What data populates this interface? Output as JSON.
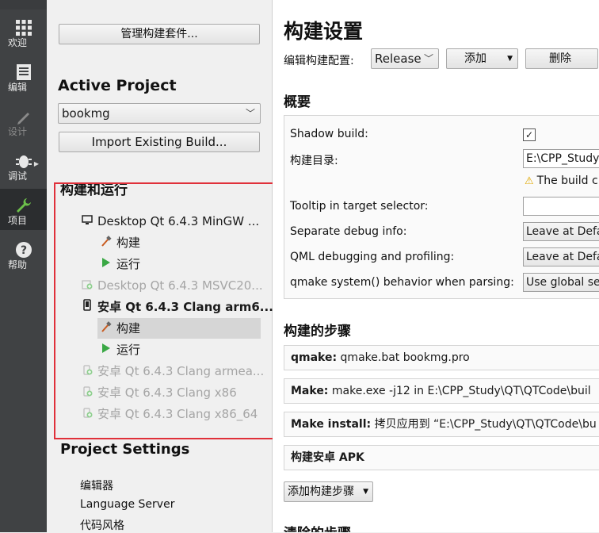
{
  "modebar": {
    "items": [
      {
        "label": "欢迎",
        "icon": "grid-icon"
      },
      {
        "label": "编辑",
        "icon": "document-icon"
      },
      {
        "label": "设计",
        "icon": "pen-icon"
      },
      {
        "label": "调试",
        "icon": "bug-icon"
      },
      {
        "label": "项目",
        "icon": "wrench-icon"
      },
      {
        "label": "帮助",
        "icon": "help-icon"
      }
    ]
  },
  "left": {
    "manage_kits_button": "管理构建套件...",
    "active_project_heading": "Active Project",
    "project_combo": "bookmg",
    "import_build_button": "Import Existing Build...",
    "build_run_heading": "构建和运行",
    "tree": [
      {
        "label": "Desktop Qt 6.4.3 MinGW ..."
      },
      {
        "label": "构建"
      },
      {
        "label": "运行"
      },
      {
        "label": "Desktop Qt 6.4.3 MSVC20..."
      },
      {
        "label": "安卓 Qt 6.4.3 Clang arm6..."
      },
      {
        "label": "构建"
      },
      {
        "label": "运行"
      },
      {
        "label": "安卓 Qt 6.4.3 Clang armea..."
      },
      {
        "label": "安卓 Qt 6.4.3 Clang x86"
      },
      {
        "label": "安卓 Qt 6.4.3 Clang x86_64"
      }
    ],
    "project_settings_heading": "Project Settings",
    "settings_items": [
      "编辑器",
      "Language Server",
      "代码风格"
    ]
  },
  "main": {
    "title": "构建设置",
    "edit_config_label": "编辑构建配置:",
    "config_value": "Release",
    "add_button": "添加",
    "delete_button": "删除",
    "overview_title": "概要",
    "shadow_build_label": "Shadow build:",
    "build_dir_label": "构建目录:",
    "build_dir_value": "E:\\CPP_Study",
    "warning_text": "The build c",
    "tooltip_label": "Tooltip in target selector:",
    "tooltip_value": "",
    "separate_debug_label": "Separate debug info:",
    "separate_debug_value": "Leave at Defa",
    "qml_debug_label": "QML debugging and profiling:",
    "qml_debug_value": "Leave at Defa",
    "qmake_system_label": "qmake system() behavior when parsing:",
    "qmake_system_value": "Use global se",
    "build_steps_title": "构建的步骤",
    "steps": [
      {
        "name": "qmake:",
        "detail": "qmake.bat bookmg.pro"
      },
      {
        "name": "Make:",
        "detail": "make.exe -j12 in E:\\CPP_Study\\QT\\QTCode\\buil"
      },
      {
        "name": "Make install:",
        "detail": "拷贝应用到 “E:\\CPP_Study\\QT\\QTCode\\bu"
      },
      {
        "name": "构建安卓 APK",
        "detail": ""
      }
    ],
    "add_step_button": "添加构建步骤",
    "clean_steps_title": "清除的步骤"
  },
  "colors": {
    "modebar_bg": "#404244",
    "highlight_box": "#e0303a",
    "run_icon": "#3aa845",
    "build_icon": "#c85a1e"
  }
}
